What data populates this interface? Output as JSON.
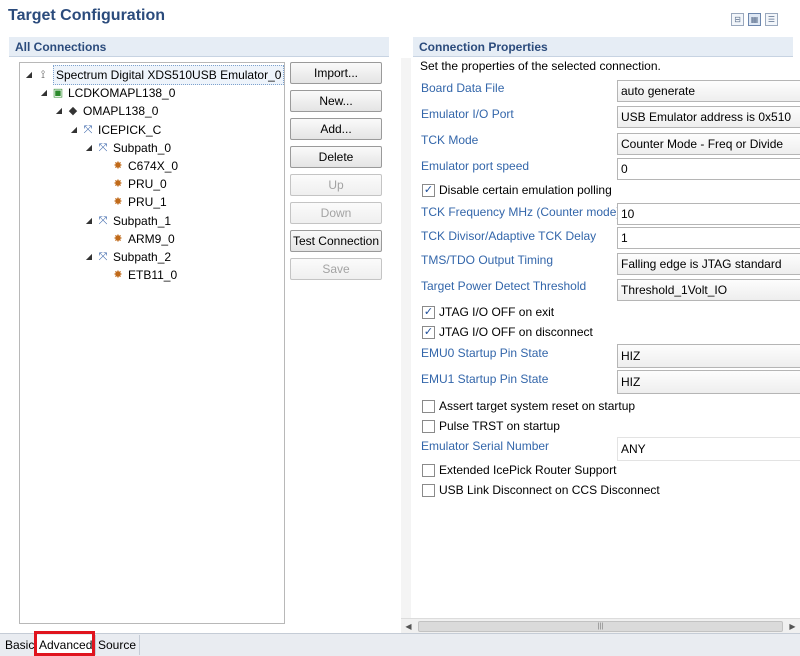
{
  "header": {
    "title": "Target Configuration"
  },
  "left_section": {
    "title": "All Connections"
  },
  "tree": [
    {
      "label": "Spectrum Digital XDS510USB Emulator_0",
      "icon": "emulator-icon",
      "level": 0,
      "twisty": "▲"
    },
    {
      "label": "LCDKOMAPL138_0",
      "icon": "board-icon",
      "level": 1,
      "twisty": "▲"
    },
    {
      "label": "OMAPL138_0",
      "icon": "chip-icon",
      "level": 2,
      "twisty": "▲"
    },
    {
      "label": "ICEPICK_C",
      "icon": "router-icon",
      "level": 3,
      "twisty": "▲"
    },
    {
      "label": "Subpath_0",
      "icon": "subpath-icon",
      "level": 4,
      "twisty": "▲"
    },
    {
      "label": "C674X_0",
      "icon": "cpu-icon",
      "level": 5,
      "twisty": ""
    },
    {
      "label": "PRU_0",
      "icon": "cpu-icon",
      "level": 5,
      "twisty": ""
    },
    {
      "label": "PRU_1",
      "icon": "cpu-icon",
      "level": 5,
      "twisty": ""
    },
    {
      "label": "Subpath_1",
      "icon": "subpath-icon",
      "level": 4,
      "twisty": "▲"
    },
    {
      "label": "ARM9_0",
      "icon": "cpu-icon",
      "level": 5,
      "twisty": ""
    },
    {
      "label": "Subpath_2",
      "icon": "subpath-icon",
      "level": 4,
      "twisty": "▲"
    },
    {
      "label": "ETB11_0",
      "icon": "cpu-icon",
      "level": 5,
      "twisty": ""
    }
  ],
  "buttons": {
    "import": "Import...",
    "new": "New...",
    "add": "Add...",
    "delete": "Delete",
    "up": "Up",
    "down": "Down",
    "test": "Test Connection",
    "save": "Save"
  },
  "right_section": {
    "title": "Connection Properties",
    "subtitle": "Set the properties of the selected connection."
  },
  "properties": {
    "board_data_file": {
      "label": "Board Data File",
      "value": "auto generate"
    },
    "emulator_io_port": {
      "label": "Emulator I/O Port",
      "value": "USB Emulator address is 0x510"
    },
    "tck_mode": {
      "label": "TCK Mode",
      "value": "Counter Mode - Freq or Divide"
    },
    "emulator_port_speed": {
      "label": "Emulator port speed",
      "value": "0"
    },
    "disable_polling": {
      "label": "Disable certain emulation polling",
      "checked": true
    },
    "tck_frequency": {
      "label": "TCK Frequency MHz (Counter mode)",
      "value": "10"
    },
    "tck_divisor": {
      "label": "TCK Divisor/Adaptive TCK Delay",
      "value": "1"
    },
    "tms_tdo": {
      "label": "TMS/TDO Output Timing",
      "value": "Falling edge is JTAG standard"
    },
    "power_detect": {
      "label": "Target Power Detect Threshold",
      "value": "Threshold_1Volt_IO"
    },
    "jtag_off_exit": {
      "label": "JTAG I/O OFF on exit",
      "checked": true
    },
    "jtag_off_disconnect": {
      "label": "JTAG I/O OFF on disconnect",
      "checked": true
    },
    "emu0_state": {
      "label": "EMU0 Startup Pin State",
      "value": "HIZ"
    },
    "emu1_state": {
      "label": "EMU1 Startup Pin State",
      "value": "HIZ"
    },
    "assert_reset": {
      "label": "Assert target system reset on startup",
      "checked": false
    },
    "pulse_trst": {
      "label": "Pulse TRST on startup",
      "checked": false
    },
    "serial_number": {
      "label": "Emulator Serial Number",
      "value": "ANY"
    },
    "icepick_router": {
      "label": "Extended IcePick Router Support",
      "checked": false
    },
    "usb_disconnect": {
      "label": "USB Link Disconnect on CCS Disconnect",
      "checked": false
    }
  },
  "tabs": {
    "basic": "Basic",
    "advanced": "Advanced",
    "source": "Source",
    "active": "Advanced"
  },
  "colors": {
    "title": "#2b4b7c",
    "label": "#3366aa",
    "highlight": "#e0141e"
  }
}
